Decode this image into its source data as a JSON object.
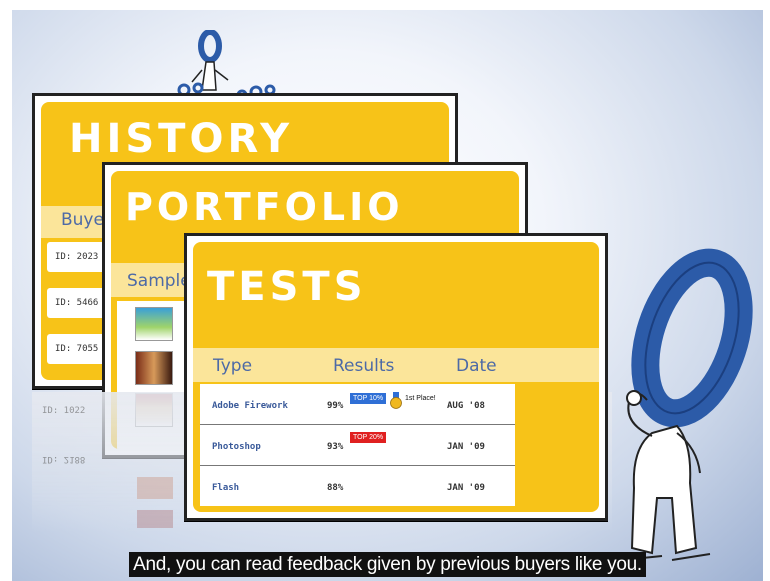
{
  "cards": {
    "history": {
      "title": "HISTORY",
      "column": "Buye",
      "ids": [
        "ID: 2023",
        "ID: 5466",
        "ID: 7055"
      ]
    },
    "portfolio": {
      "title": "PORTFOLIO",
      "column": "Sample"
    },
    "tests": {
      "title": "TESTS",
      "headers": {
        "type": "Type",
        "results": "Results",
        "date": "Date"
      },
      "rows": [
        {
          "type": "Adobe Firework",
          "result": "99%",
          "badge": "TOP 10%",
          "award": "1st Place!",
          "date": "AUG '08"
        },
        {
          "type": "Photoshop",
          "result": "93%",
          "badge": "TOP 20%",
          "date": "JAN '09"
        },
        {
          "type": "Flash",
          "result": "88%",
          "date": "JAN '09"
        }
      ]
    }
  },
  "reflection_ids": [
    "ID: 1022",
    "ID: 2188"
  ],
  "colors": {
    "card_yellow": "#f7c318",
    "header_band": "#fbe59a",
    "header_text": "#4d6aa6",
    "badge_blue": "#2f6fd6",
    "badge_red": "#e02020",
    "mascot_blue": "#2c5ba8"
  },
  "icons": [
    "mascot-o-character",
    "gold-medal-icon"
  ],
  "caption": "And, you can read feedback given by previous buyers like you."
}
